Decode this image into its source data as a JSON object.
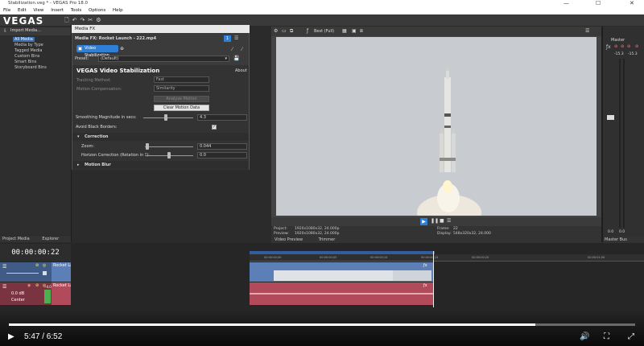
{
  "window": {
    "title": "Stabilization.veg * - VEGAS Pro 18.0",
    "min": "—",
    "max": "☐",
    "close": "✕"
  },
  "menu": [
    "File",
    "Edit",
    "View",
    "Insert",
    "Tools",
    "Options",
    "Help"
  ],
  "logo": "VEGAS",
  "explorer": {
    "import_label": "Import Media...",
    "items": [
      "All Media",
      "Media by Type",
      "Tagged Media",
      "Custom Bins",
      "Smart Bins",
      "Storyboard Bins"
    ],
    "tabs": [
      "Project Media",
      "Explorer"
    ]
  },
  "mediafx": {
    "title": "Media FX",
    "header": "Media FX:  Rocket Launch - 222.mp4",
    "chip": "Video Stabilization",
    "preset_label": "Preset:",
    "preset_value": "(Default)",
    "heading": "VEGAS Video Stabilization",
    "about": "About",
    "tracking_method_label": "Tracking Method:",
    "tracking_method_value": "Fast",
    "motion_comp_label": "Motion Compensation:",
    "motion_comp_value": "Similarity",
    "analyze_button": "Analyze Motion",
    "clear_button": "Clear Motion Data",
    "smoothing_label": "Smoothing Magnitude in secs:",
    "smoothing_value": "4.3",
    "smoothing_level": 0.45,
    "avoid_black_label": "Avoid Black Borders:",
    "avoid_black_checked": true,
    "correction_label": "Correction",
    "zoom_label": "Zoom:",
    "zoom_value": "0.044",
    "zoom_level": 0.05,
    "horizon_label": "Horizon Correction (Rotation in °):",
    "horizon_value": "0.0",
    "horizon_level": 0.5,
    "motion_blur_label": "Motion Blur"
  },
  "preview": {
    "quality": "Best (Full)",
    "project_label": "Project:",
    "project_value": "1920x1080x32, 24.000p",
    "preview_label": "Preview:",
    "preview_value": "1920x1080x32, 24.000p",
    "frame_label": "Frame:",
    "frame_value": "22",
    "display_label": "Display:",
    "display_value": "548x320x32, 24.000",
    "tabs": [
      "Video Preview",
      "Trimmer"
    ]
  },
  "master": {
    "label": "Master",
    "levels": [
      "-15.3",
      "-15.3"
    ],
    "bottom": [
      "0.0",
      "0.0"
    ],
    "tab": "Master Bus"
  },
  "timeline": {
    "timecode": "00:00:00:22",
    "ruler_marks": [
      "00:00:00;00",
      "00:00:00;05",
      "00:00:00;10",
      "00:00:00;15",
      "00:00:00;20",
      "00:00:01;00"
    ],
    "video_track_event": "Rocket Launch",
    "audio_track_event": "Rocket Launch",
    "audio_vol": "0.0 dB",
    "audio_pan": "Center",
    "audio_gain": "-4.0"
  },
  "player": {
    "time": "5:47 / 6:52",
    "progress": 0.84
  },
  "colors": {
    "video_event": "#5b7fb6",
    "audio_event": "#b14a5b",
    "selection": "#3a72b0",
    "sky": "#c9cdd0"
  }
}
